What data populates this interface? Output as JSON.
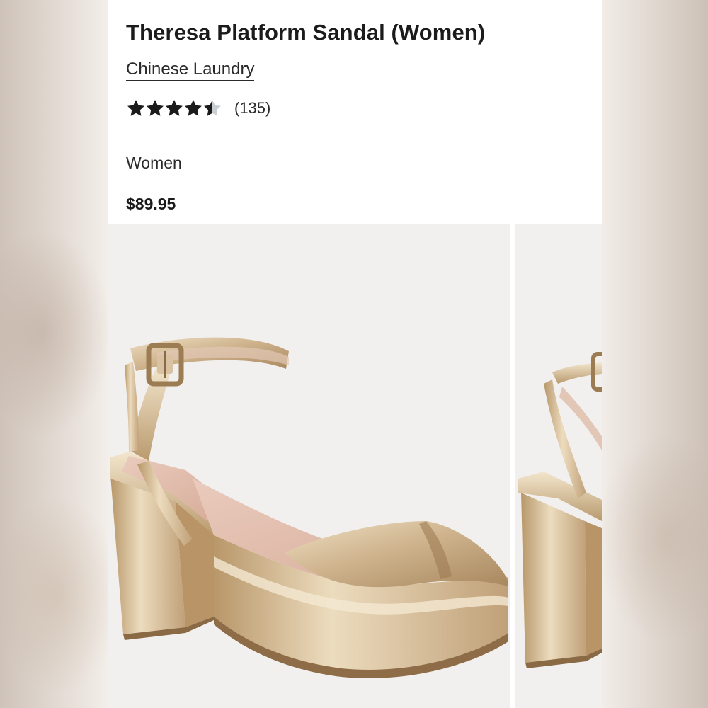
{
  "product": {
    "title": "Theresa Platform Sandal (Women)",
    "brand": "Chinese Laundry",
    "rating": {
      "value": 4.5,
      "max": 5,
      "review_count_label": "(135)"
    },
    "category": "Women",
    "price": "$89.95"
  },
  "gallery": {
    "images": [
      {
        "name": "product-image-main",
        "subject": "gold metallic platform sandal with ankle strap"
      },
      {
        "name": "product-image-next",
        "subject": "gold metallic platform sandal side view"
      }
    ]
  },
  "colors": {
    "text": "#1b1b1b",
    "star_filled": "#1b1b1b",
    "star_empty": "#c9cfd3",
    "image_background": "#f1f0ee",
    "shoe_gold": "#d8c2a2"
  }
}
